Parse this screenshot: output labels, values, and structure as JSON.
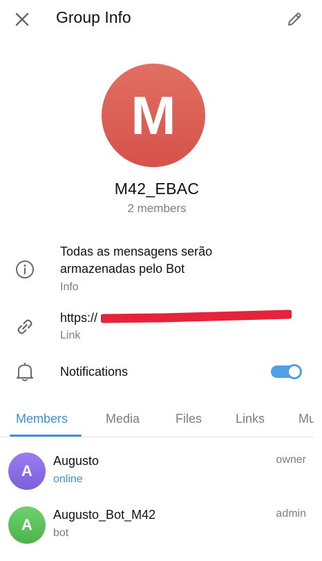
{
  "header": {
    "close_icon": "close-icon",
    "title": "Group Info",
    "edit_icon": "pencil-icon"
  },
  "group": {
    "avatar_letter": "M",
    "avatar_color": "#dc5d55",
    "name": "M42_EBAC",
    "members_count": "2 members"
  },
  "info": {
    "icon": "info-icon",
    "text": "Todas as mensagens serão armazenadas pelo Bot",
    "label": "Info"
  },
  "link": {
    "icon": "link-icon",
    "text": "https://",
    "label": "Link"
  },
  "notifications": {
    "icon": "bell-icon",
    "label": "Notifications",
    "enabled": true,
    "accent": "#4fa0e5"
  },
  "tabs": [
    {
      "label": "Members",
      "active": true
    },
    {
      "label": "Media",
      "active": false
    },
    {
      "label": "Files",
      "active": false
    },
    {
      "label": "Links",
      "active": false
    },
    {
      "label": "Mu",
      "active": false
    }
  ],
  "members": [
    {
      "initial": "A",
      "name": "Augusto",
      "status": "online",
      "role": "owner",
      "avatar_color": "#8e6fe2",
      "status_color": "#3e8fd6"
    },
    {
      "initial": "A",
      "name": "Augusto_Bot_M42",
      "status": "bot",
      "role": "admin",
      "avatar_color": "#5fc25e",
      "status_color": "#7d7d7d"
    }
  ]
}
